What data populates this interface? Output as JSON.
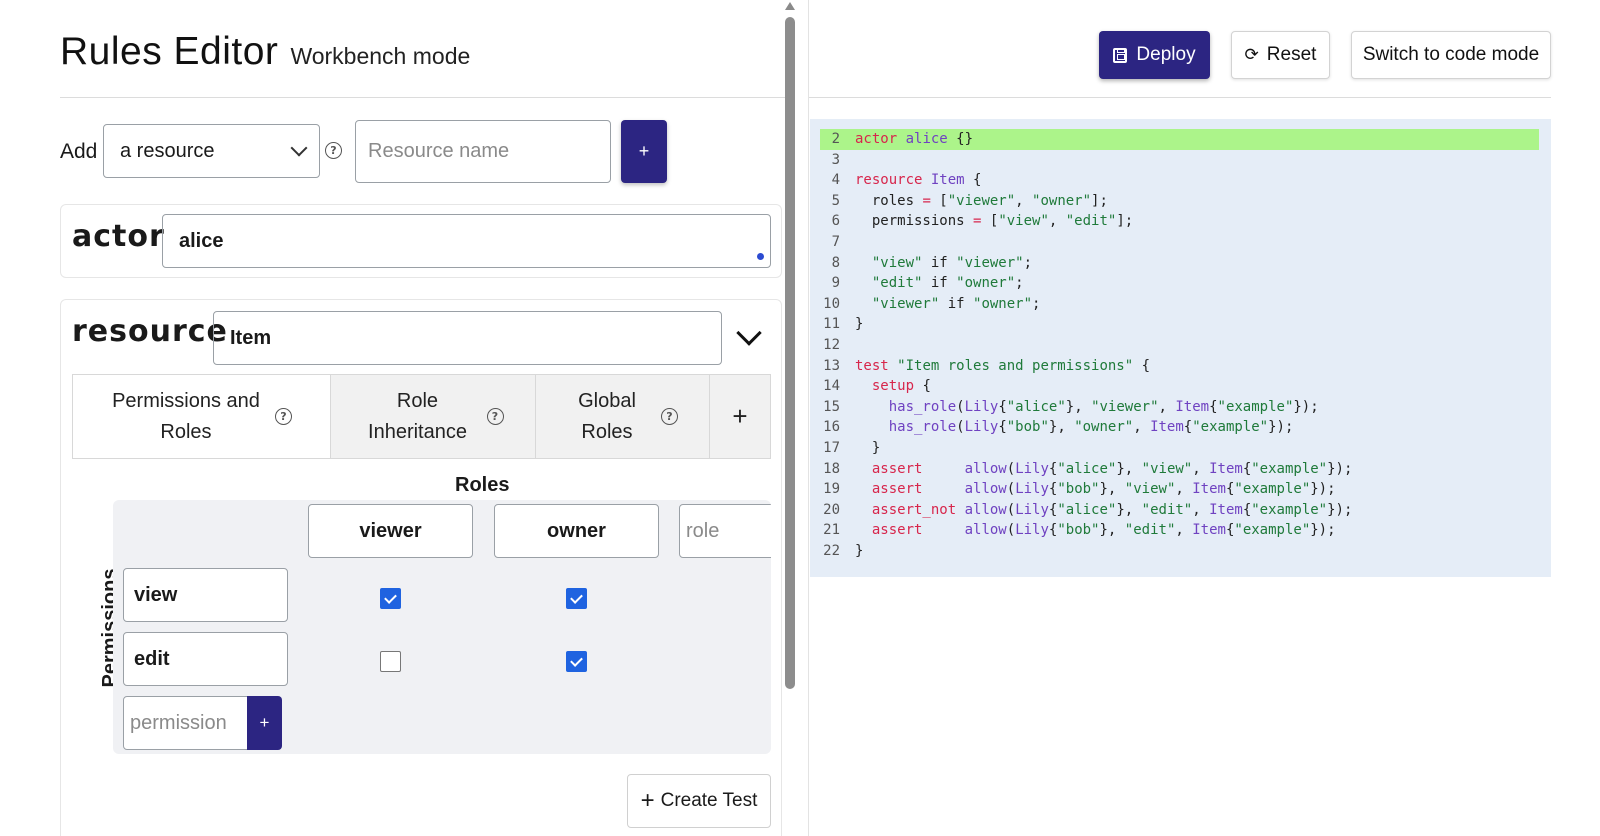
{
  "header": {
    "title": "Rules Editor",
    "subtitle": "Workbench mode"
  },
  "toolbar": {
    "deploy_label": "Deploy",
    "reset_label": "Reset",
    "switch_label": "Switch to code mode"
  },
  "add_row": {
    "label": "Add",
    "select_value": "a resource",
    "name_placeholder": "Resource name",
    "add_button": "+"
  },
  "actor": {
    "keyword": "actor",
    "name": "alice"
  },
  "resource": {
    "keyword": "resource",
    "name": "Item",
    "tabs": [
      {
        "label": "Permissions and Roles"
      },
      {
        "label": "Role Inheritance"
      },
      {
        "label": "Global Roles"
      },
      {
        "label": "+"
      }
    ],
    "matrix": {
      "roles_title": "Roles",
      "permissions_title": "Permissions",
      "roles": [
        "viewer",
        "owner"
      ],
      "role_placeholder": "role",
      "permissions": [
        "view",
        "edit"
      ],
      "permission_placeholder": "permission",
      "add_permission_button": "+",
      "grants": [
        [
          true,
          true
        ],
        [
          false,
          true
        ]
      ]
    },
    "create_test_label": "Create Test",
    "create_test_plus": "+"
  },
  "code": {
    "lines": [
      {
        "n": "2",
        "parts": [
          [
            "k",
            "actor"
          ],
          [
            "p",
            " "
          ],
          [
            "t",
            "alice"
          ],
          [
            "p",
            " {}"
          ]
        ]
      },
      {
        "n": "3",
        "parts": []
      },
      {
        "n": "4",
        "parts": [
          [
            "k",
            "resource"
          ],
          [
            "p",
            " "
          ],
          [
            "t",
            "Item"
          ],
          [
            "p",
            " {"
          ]
        ]
      },
      {
        "n": "5",
        "parts": [
          [
            "p",
            "  roles "
          ],
          [
            "k",
            "="
          ],
          [
            "p",
            " ["
          ],
          [
            "s",
            "\"viewer\""
          ],
          [
            "p",
            ", "
          ],
          [
            "s",
            "\"owner\""
          ],
          [
            "p",
            "];"
          ]
        ]
      },
      {
        "n": "6",
        "parts": [
          [
            "p",
            "  permissions "
          ],
          [
            "k",
            "="
          ],
          [
            "p",
            " ["
          ],
          [
            "s",
            "\"view\""
          ],
          [
            "p",
            ", "
          ],
          [
            "s",
            "\"edit\""
          ],
          [
            "p",
            "];"
          ]
        ]
      },
      {
        "n": "7",
        "parts": []
      },
      {
        "n": "8",
        "parts": [
          [
            "p",
            "  "
          ],
          [
            "s",
            "\"view\""
          ],
          [
            "p",
            " if "
          ],
          [
            "s",
            "\"viewer\""
          ],
          [
            "p",
            ";"
          ]
        ]
      },
      {
        "n": "9",
        "parts": [
          [
            "p",
            "  "
          ],
          [
            "s",
            "\"edit\""
          ],
          [
            "p",
            " if "
          ],
          [
            "s",
            "\"owner\""
          ],
          [
            "p",
            ";"
          ]
        ]
      },
      {
        "n": "10",
        "parts": [
          [
            "p",
            "  "
          ],
          [
            "s",
            "\"viewer\""
          ],
          [
            "p",
            " if "
          ],
          [
            "s",
            "\"owner\""
          ],
          [
            "p",
            ";"
          ]
        ]
      },
      {
        "n": "11",
        "parts": [
          [
            "p",
            "}"
          ]
        ]
      },
      {
        "n": "12",
        "parts": []
      },
      {
        "n": "13",
        "parts": [
          [
            "k",
            "test"
          ],
          [
            "p",
            " "
          ],
          [
            "s",
            "\"Item roles and permissions\""
          ],
          [
            "p",
            " {"
          ]
        ]
      },
      {
        "n": "14",
        "parts": [
          [
            "p",
            "  "
          ],
          [
            "k",
            "setup"
          ],
          [
            "p",
            " {"
          ]
        ]
      },
      {
        "n": "15",
        "parts": [
          [
            "p",
            "    "
          ],
          [
            "t",
            "has_role"
          ],
          [
            "p",
            "("
          ],
          [
            "t",
            "Lily"
          ],
          [
            "p",
            "{"
          ],
          [
            "s",
            "\"alice\""
          ],
          [
            "p",
            "}, "
          ],
          [
            "s",
            "\"viewer\""
          ],
          [
            "p",
            ", "
          ],
          [
            "t",
            "Item"
          ],
          [
            "p",
            "{"
          ],
          [
            "s",
            "\"example\""
          ],
          [
            "p",
            "});"
          ]
        ]
      },
      {
        "n": "16",
        "parts": [
          [
            "p",
            "    "
          ],
          [
            "t",
            "has_role"
          ],
          [
            "p",
            "("
          ],
          [
            "t",
            "Lily"
          ],
          [
            "p",
            "{"
          ],
          [
            "s",
            "\"bob\""
          ],
          [
            "p",
            "}, "
          ],
          [
            "s",
            "\"owner\""
          ],
          [
            "p",
            ", "
          ],
          [
            "t",
            "Item"
          ],
          [
            "p",
            "{"
          ],
          [
            "s",
            "\"example\""
          ],
          [
            "p",
            "});"
          ]
        ]
      },
      {
        "n": "17",
        "parts": [
          [
            "p",
            "  }"
          ]
        ]
      },
      {
        "n": "18",
        "parts": [
          [
            "p",
            "  "
          ],
          [
            "k",
            "assert"
          ],
          [
            "p",
            "     "
          ],
          [
            "t",
            "allow"
          ],
          [
            "p",
            "("
          ],
          [
            "t",
            "Lily"
          ],
          [
            "p",
            "{"
          ],
          [
            "s",
            "\"alice\""
          ],
          [
            "p",
            "}, "
          ],
          [
            "s",
            "\"view\""
          ],
          [
            "p",
            ", "
          ],
          [
            "t",
            "Item"
          ],
          [
            "p",
            "{"
          ],
          [
            "s",
            "\"example\""
          ],
          [
            "p",
            "});"
          ]
        ]
      },
      {
        "n": "19",
        "parts": [
          [
            "p",
            "  "
          ],
          [
            "k",
            "assert"
          ],
          [
            "p",
            "     "
          ],
          [
            "t",
            "allow"
          ],
          [
            "p",
            "("
          ],
          [
            "t",
            "Lily"
          ],
          [
            "p",
            "{"
          ],
          [
            "s",
            "\"bob\""
          ],
          [
            "p",
            "}, "
          ],
          [
            "s",
            "\"view\""
          ],
          [
            "p",
            ", "
          ],
          [
            "t",
            "Item"
          ],
          [
            "p",
            "{"
          ],
          [
            "s",
            "\"example\""
          ],
          [
            "p",
            "});"
          ]
        ]
      },
      {
        "n": "20",
        "parts": [
          [
            "p",
            "  "
          ],
          [
            "k",
            "assert_not"
          ],
          [
            "p",
            " "
          ],
          [
            "t",
            "allow"
          ],
          [
            "p",
            "("
          ],
          [
            "t",
            "Lily"
          ],
          [
            "p",
            "{"
          ],
          [
            "s",
            "\"alice\""
          ],
          [
            "p",
            "}, "
          ],
          [
            "s",
            "\"edit\""
          ],
          [
            "p",
            ", "
          ],
          [
            "t",
            "Item"
          ],
          [
            "p",
            "{"
          ],
          [
            "s",
            "\"example\""
          ],
          [
            "p",
            "});"
          ]
        ]
      },
      {
        "n": "21",
        "parts": [
          [
            "p",
            "  "
          ],
          [
            "k",
            "assert"
          ],
          [
            "p",
            "     "
          ],
          [
            "t",
            "allow"
          ],
          [
            "p",
            "("
          ],
          [
            "t",
            "Lily"
          ],
          [
            "p",
            "{"
          ],
          [
            "s",
            "\"bob\""
          ],
          [
            "p",
            "}, "
          ],
          [
            "s",
            "\"edit\""
          ],
          [
            "p",
            ", "
          ],
          [
            "t",
            "Item"
          ],
          [
            "p",
            "{"
          ],
          [
            "s",
            "\"example\""
          ],
          [
            "p",
            "});"
          ]
        ]
      },
      {
        "n": "22",
        "parts": [
          [
            "p",
            "}"
          ]
        ]
      }
    ]
  },
  "colors": {
    "primary": "#2c2582",
    "checkbox": "#1f63e0",
    "code_bg": "#e5edf7",
    "code_highlight": "#acf48a",
    "keyword": "#d7264c",
    "type": "#6f42c1",
    "string": "#1f7a3a"
  },
  "icons": [
    "help-icon",
    "chevron-down-icon",
    "save-icon",
    "refresh-icon",
    "plus-icon"
  ]
}
